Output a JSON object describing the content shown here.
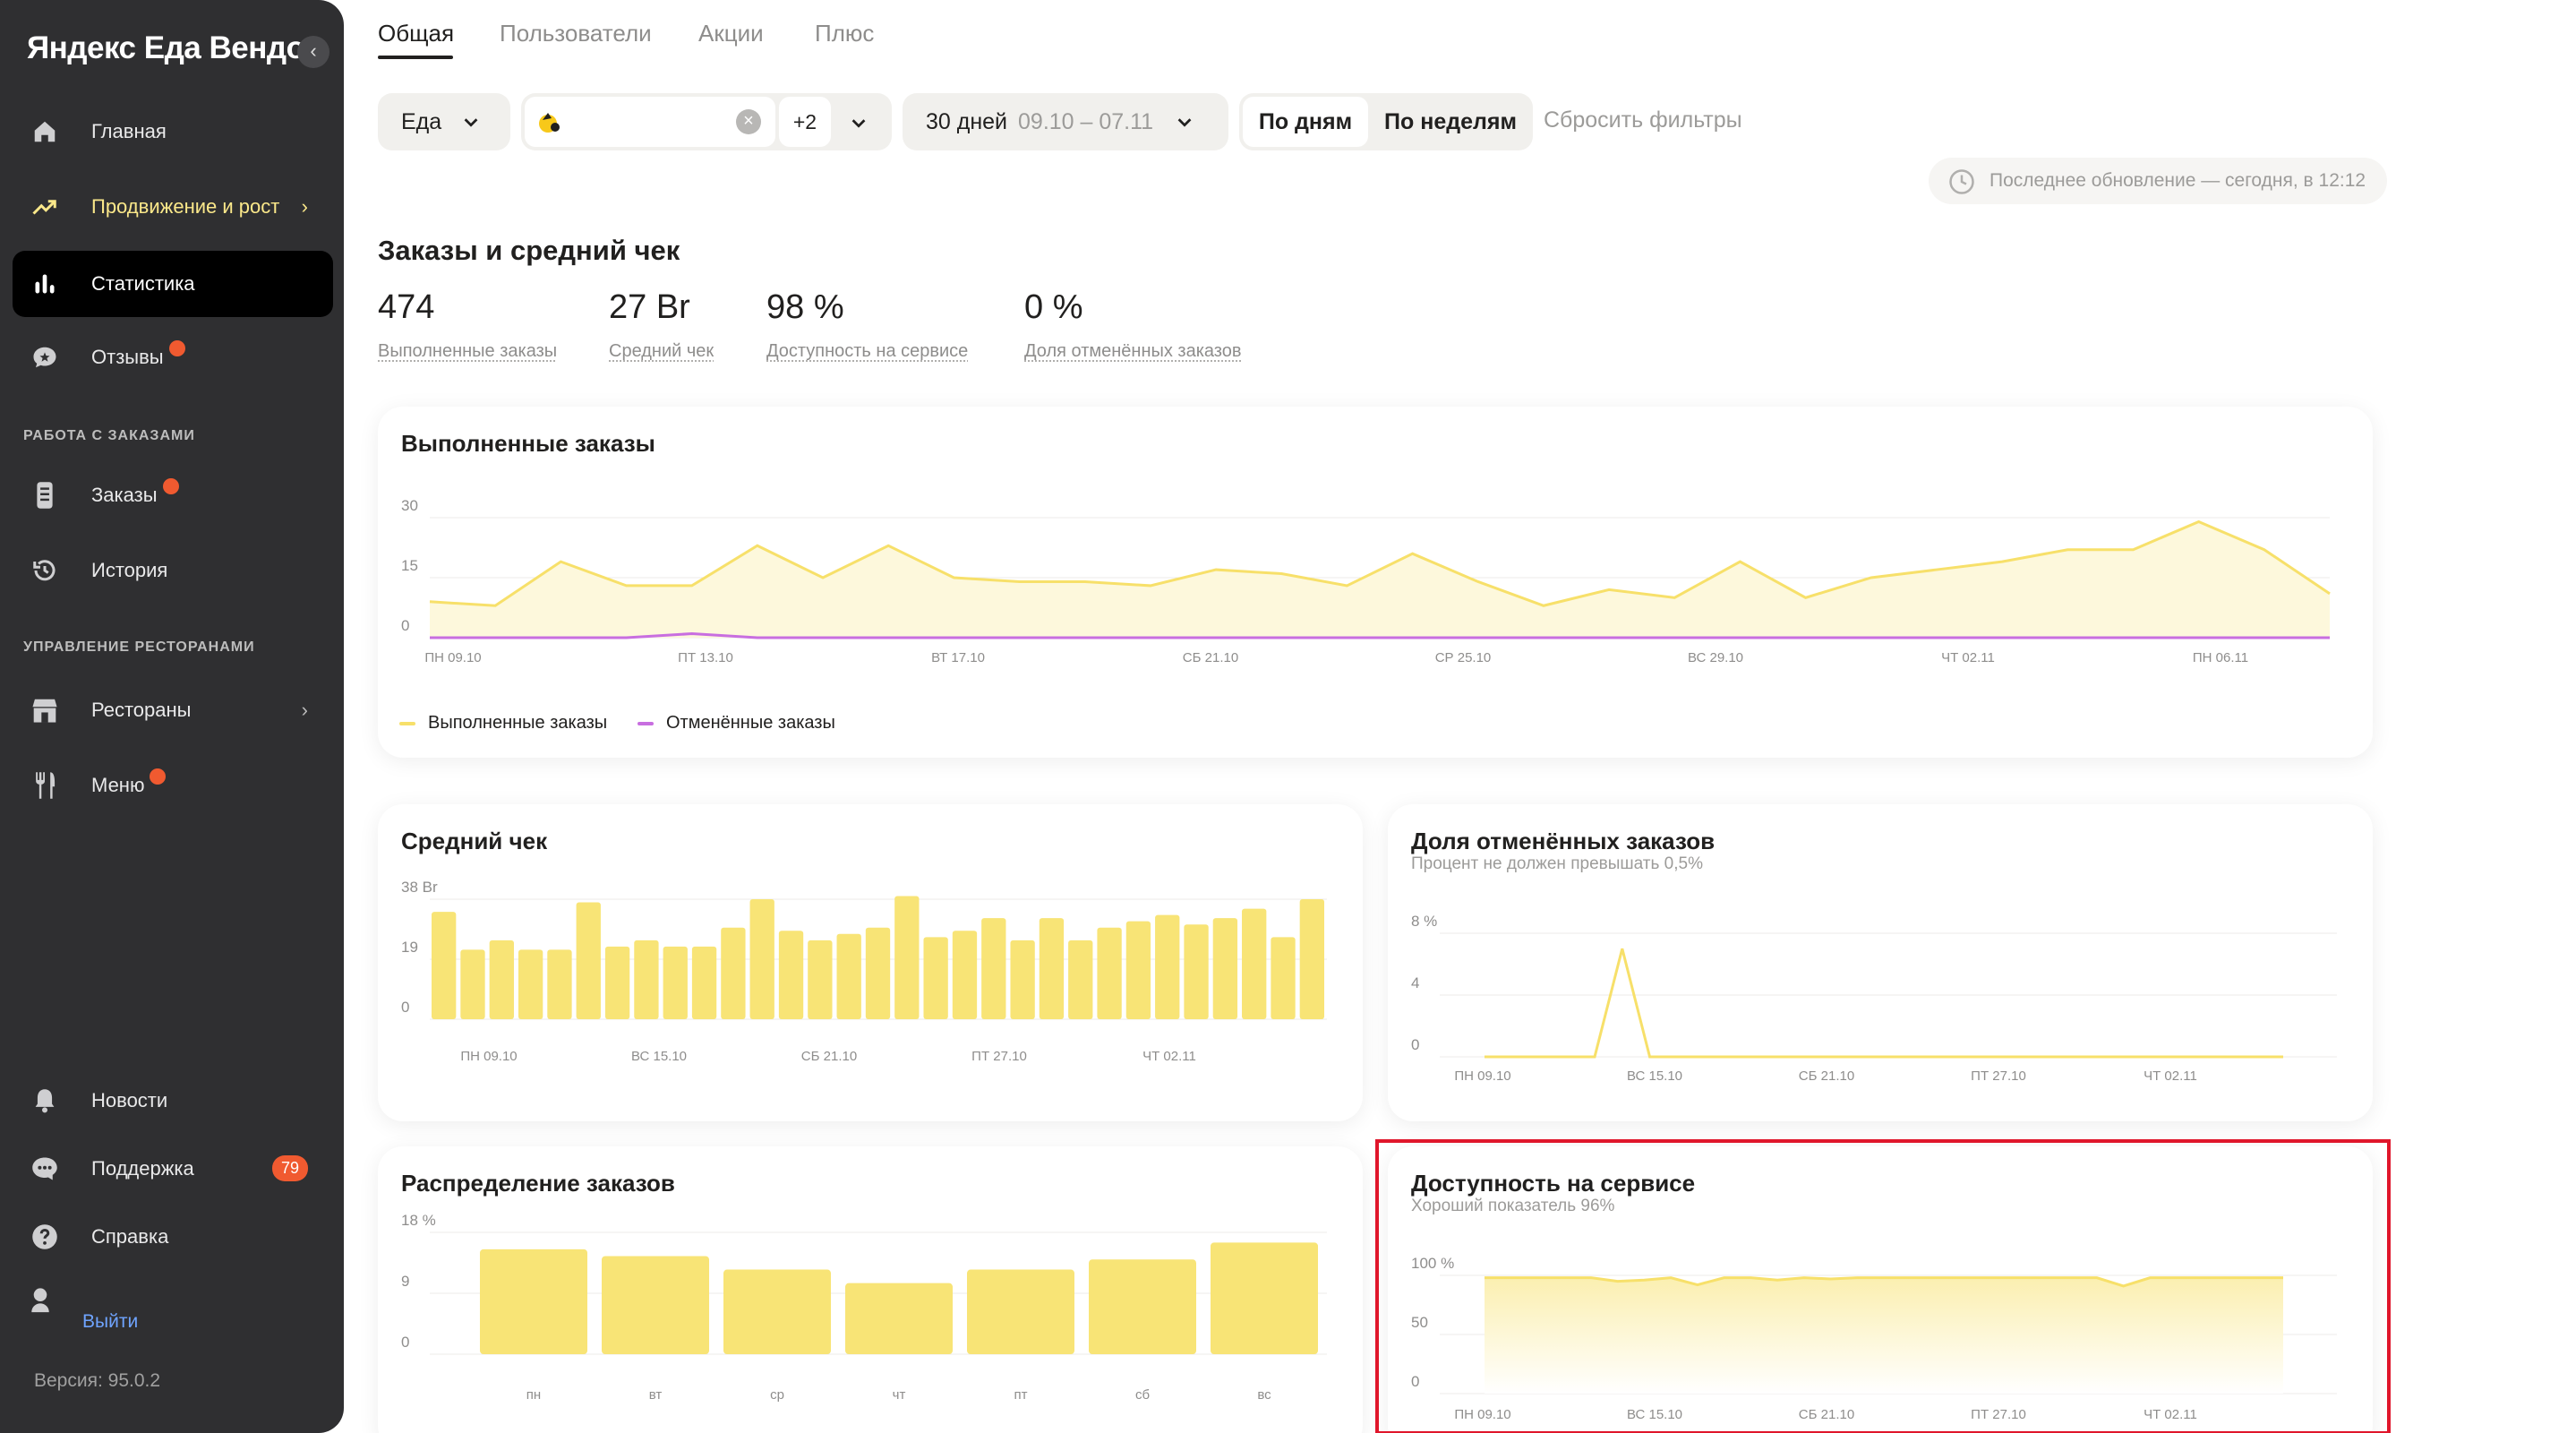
{
  "sidebar": {
    "brand": "Яндекс Еда Вендор",
    "collapse_icon": "chevron-left-icon",
    "items": [
      {
        "label": "Главная",
        "icon": "home-icon"
      },
      {
        "label": "Продвижение и рост",
        "icon": "trend-up-icon"
      },
      {
        "label": "Статистика",
        "icon": "bar-chart-icon"
      },
      {
        "label": "Отзывы",
        "icon": "review-icon"
      },
      {
        "label": "Заказы",
        "icon": "orders-icon"
      },
      {
        "label": "История",
        "icon": "history-icon"
      },
      {
        "label": "Рестораны",
        "icon": "store-icon"
      },
      {
        "label": "Меню",
        "icon": "fork-knife-icon"
      },
      {
        "label": "Новости",
        "icon": "bell-icon"
      },
      {
        "label": "Поддержка",
        "icon": "chat-icon",
        "count": "79"
      },
      {
        "label": "Справка",
        "icon": "help-icon"
      }
    ],
    "section_orders": "РАБОТА С ЗАКАЗАМИ",
    "section_restaurants": "УПРАВЛЕНИЕ РЕСТОРАНАМИ",
    "logout": "Выйти",
    "version": "Версия: 95.0.2"
  },
  "tabs": [
    "Общая",
    "Пользователи",
    "Акции",
    "Плюс"
  ],
  "filters": {
    "service": "Еда",
    "restaurant_more": "+2",
    "period_label": "30 дней",
    "period_range": "09.10 – 07.11",
    "by_days": "По дням",
    "by_weeks": "По неделям",
    "reset": "Сбросить фильтры",
    "updated": "Последнее обновление — сегодня, в 12:12"
  },
  "summary": {
    "title": "Заказы и средний чек",
    "metrics": [
      {
        "value": "474",
        "label": "Выполненные заказы"
      },
      {
        "value": "27 Br",
        "label": "Средний чек"
      },
      {
        "value": "98 %",
        "label": "Доступность на сервисе"
      },
      {
        "value": "0 %",
        "label": "Доля отменённых заказов"
      }
    ]
  },
  "colors": {
    "accent_yellow": "#f7e06a",
    "purple": "#c86ee0",
    "sidebar": "#2f2f31",
    "highlight": "#e0162b"
  },
  "chart_data": [
    {
      "type": "line",
      "title": "Выполненные заказы",
      "ylim": [
        0,
        30
      ],
      "yticks": [
        "30",
        "15",
        "0"
      ],
      "x_labels": [
        "ПН 09.10",
        "ПТ 13.10",
        "ВТ 17.10",
        "СБ 21.10",
        "СР 25.10",
        "ВС 29.10",
        "ЧТ 02.11",
        "ПН 06.11"
      ],
      "series": [
        {
          "name": "Выполненные заказы",
          "values": [
            9,
            8,
            19,
            13,
            13,
            23,
            15,
            23,
            15,
            14,
            14,
            13,
            17,
            16,
            13,
            21,
            14,
            8,
            12,
            10,
            19,
            10,
            15,
            17,
            19,
            22,
            22,
            29,
            22,
            11
          ]
        },
        {
          "name": "Отменённые заказы",
          "values": [
            0,
            0,
            0,
            0,
            1,
            0,
            0,
            0,
            0,
            0,
            0,
            0,
            0,
            0,
            0,
            0,
            0,
            0,
            0,
            0,
            0,
            0,
            0,
            0,
            0,
            0,
            0,
            0,
            0,
            0
          ]
        }
      ]
    },
    {
      "type": "bar",
      "title": "Средний чек",
      "ylim": [
        0,
        38
      ],
      "yticks": [
        "38 Br",
        "19",
        "0"
      ],
      "x_labels": [
        "ПН 09.10",
        "ВС 15.10",
        "СБ 21.10",
        "ПТ 27.10",
        "ЧТ 02.11"
      ],
      "values": [
        34,
        22,
        25,
        22,
        22,
        37,
        23,
        25,
        23,
        23,
        29,
        38,
        28,
        25,
        27,
        29,
        39,
        26,
        28,
        32,
        25,
        32,
        25,
        29,
        31,
        33,
        30,
        32,
        35,
        26,
        38
      ]
    },
    {
      "type": "line",
      "title": "Доля отменённых заказов",
      "subtitle": "Процент не должен превышать 0,5%",
      "ylim": [
        0,
        8
      ],
      "yticks": [
        "8 %",
        "4",
        "0"
      ],
      "x_labels": [
        "ПН 09.10",
        "ВС 15.10",
        "СБ 21.10",
        "ПТ 27.10",
        "ЧТ 02.11"
      ],
      "values": [
        0,
        0,
        0,
        0,
        0,
        7,
        0,
        0,
        0,
        0,
        0,
        0,
        0,
        0,
        0,
        0,
        0,
        0,
        0,
        0,
        0,
        0,
        0,
        0,
        0,
        0,
        0,
        0,
        0,
        0
      ]
    },
    {
      "type": "bar",
      "title": "Распределение заказов",
      "ylim": [
        0,
        18
      ],
      "yticks": [
        "18 %",
        "9",
        "0"
      ],
      "categories": [
        "пн",
        "вт",
        "ср",
        "чт",
        "пт",
        "сб",
        "вс"
      ],
      "values": [
        15.5,
        14.5,
        12.5,
        10.5,
        12.5,
        14,
        16.5
      ]
    },
    {
      "type": "area",
      "title": "Доступность на сервисе",
      "subtitle": "Хороший показатель 96%",
      "ylim": [
        0,
        100
      ],
      "yticks": [
        "100 %",
        "50",
        "0"
      ],
      "x_labels": [
        "ПН 09.10",
        "ВС 15.10",
        "СБ 21.10",
        "ПТ 27.10",
        "ЧТ 02.11"
      ],
      "values": [
        98,
        98,
        98,
        98,
        98,
        95,
        96,
        98,
        92,
        98,
        98,
        96,
        98,
        97,
        98,
        98,
        98,
        98,
        98,
        98,
        98,
        98,
        98,
        98,
        91,
        98,
        98,
        98,
        98,
        98,
        98
      ]
    }
  ]
}
